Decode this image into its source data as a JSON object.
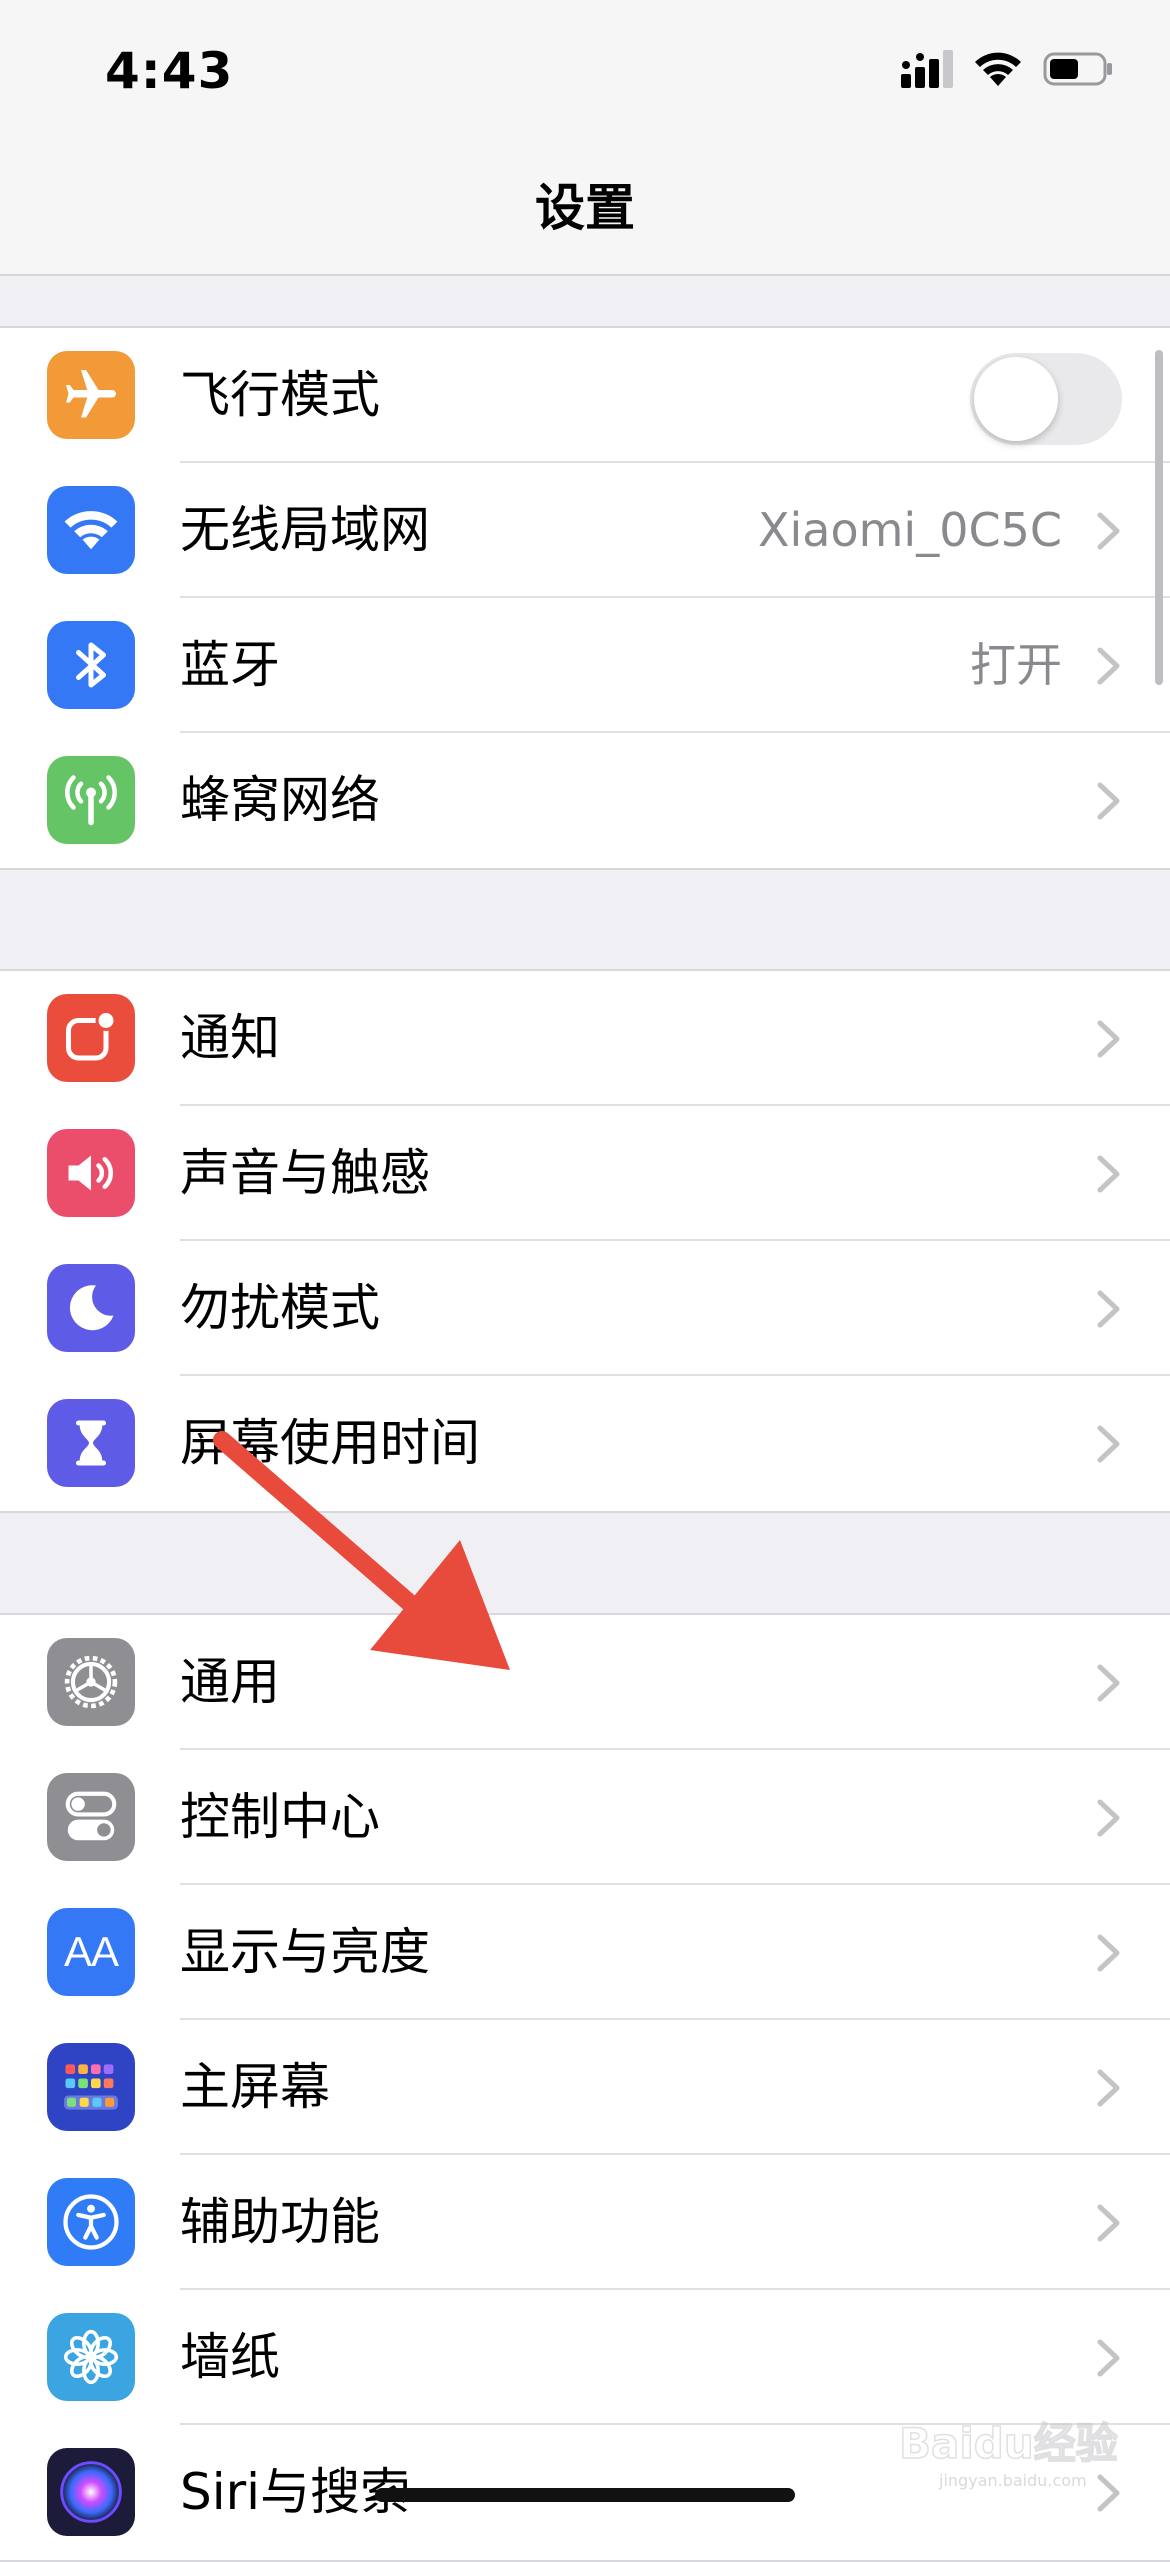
{
  "status_bar": {
    "time": "4:43"
  },
  "nav": {
    "title": "设置"
  },
  "groups": [
    {
      "items": [
        {
          "label": "飞行模式",
          "icon": "airplane-icon",
          "color": "#f19a37",
          "toggle": false
        },
        {
          "label": "无线局域网",
          "icon": "wifi-icon",
          "color": "#3478f6",
          "value": "Xiaomi_0C5C"
        },
        {
          "label": "蓝牙",
          "icon": "bluetooth-icon",
          "color": "#3478f6",
          "value": "打开"
        },
        {
          "label": "蜂窝网络",
          "icon": "cellular-antenna-icon",
          "color": "#65c466"
        }
      ]
    },
    {
      "items": [
        {
          "label": "通知",
          "icon": "notifications-icon",
          "color": "#eb4d3d"
        },
        {
          "label": "声音与触感",
          "icon": "speaker-icon",
          "color": "#ea4e6a"
        },
        {
          "label": "勿扰模式",
          "icon": "moon-icon",
          "color": "#5e5ce6"
        },
        {
          "label": "屏幕使用时间",
          "icon": "hourglass-icon",
          "color": "#5e5ce6"
        }
      ]
    },
    {
      "items": [
        {
          "label": "通用",
          "icon": "gear-icon",
          "color": "#8e8e93"
        },
        {
          "label": "控制中心",
          "icon": "toggles-icon",
          "color": "#8e8e93"
        },
        {
          "label": "显示与亮度",
          "icon": "text-size-icon",
          "color": "#3478f6",
          "icon_text": "AA"
        },
        {
          "label": "主屏幕",
          "icon": "home-screen-icon",
          "color": "#2f44c4"
        },
        {
          "label": "辅助功能",
          "icon": "accessibility-icon",
          "color": "#2f7cf6"
        },
        {
          "label": "墙纸",
          "icon": "flower-icon",
          "color": "#3aa5e0"
        },
        {
          "label": "Siri与搜索",
          "icon": "siri-icon",
          "color": "#1c1c3a"
        }
      ]
    }
  ],
  "watermark": {
    "text": "Baidu经验",
    "sub": "jingyan.baidu.com"
  }
}
